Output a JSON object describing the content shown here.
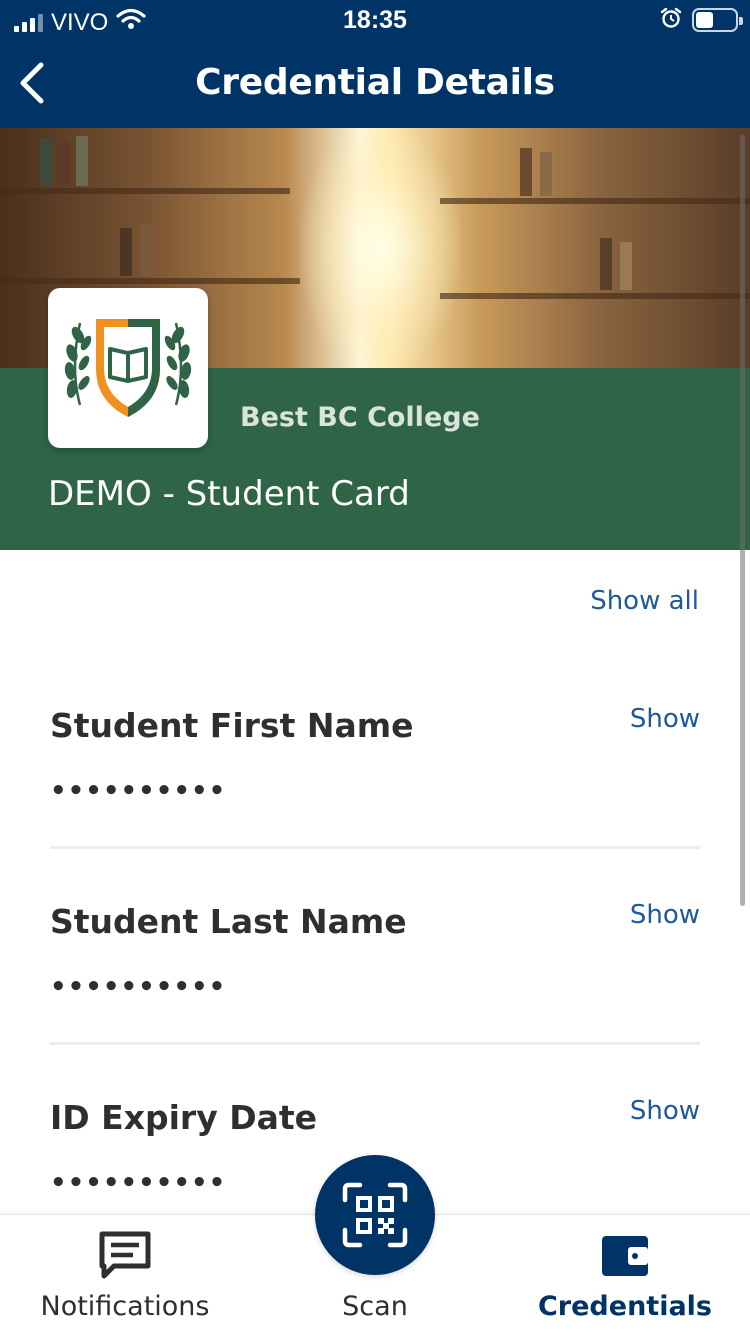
{
  "status_bar": {
    "carrier": "VIVO",
    "time": "18:35",
    "battery_level": 0.45,
    "icons": [
      "signal-icon",
      "wifi-icon",
      "alarm-icon",
      "battery-icon"
    ]
  },
  "header": {
    "title": "Credential Details",
    "back_icon": "chevron-left-icon"
  },
  "credential": {
    "issuer": "Best BC College",
    "name": "DEMO - Student Card",
    "logo_icon": "college-crest-icon"
  },
  "actions": {
    "show_all_label": "Show all"
  },
  "attributes": [
    {
      "label": "Student First Name",
      "value": "••••••••••",
      "show_label": "Show"
    },
    {
      "label": "Student Last Name",
      "value": "••••••••••",
      "show_label": "Show"
    },
    {
      "label": "ID Expiry Date",
      "value": "••••••••••",
      "show_label": "Show"
    }
  ],
  "tabs": [
    {
      "label": "Notifications",
      "icon": "chat-bubble-icon",
      "active": false
    },
    {
      "label": "Scan",
      "icon": "qr-scan-icon",
      "active": false
    },
    {
      "label": "Credentials",
      "icon": "wallet-icon",
      "active": true
    }
  ],
  "colors": {
    "header_bg": "#003366",
    "band_green": "#2f6446",
    "link_blue": "#1f5a96",
    "crest_green": "#2f6446",
    "crest_orange": "#f0901e"
  }
}
